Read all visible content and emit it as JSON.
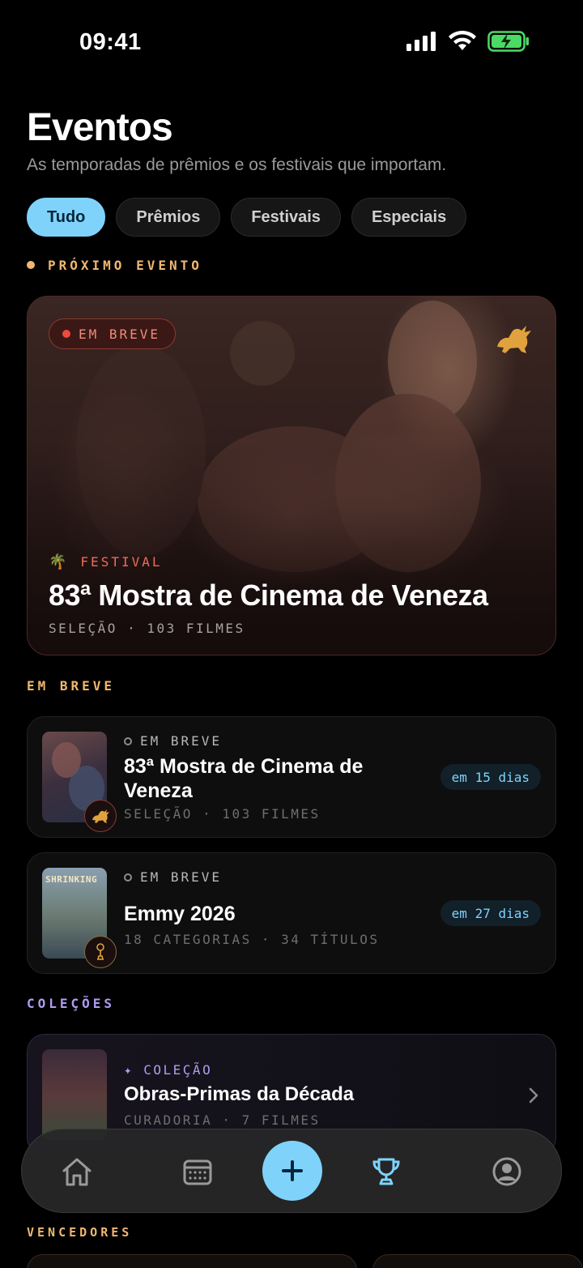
{
  "status_bar": {
    "time": "09:41"
  },
  "header": {
    "title": "Eventos",
    "subtitle": "As temporadas de prêmios e os festivais que importam."
  },
  "filters": [
    {
      "label": "Tudo",
      "active": true
    },
    {
      "label": "Prêmios",
      "active": false
    },
    {
      "label": "Festivais",
      "active": false
    },
    {
      "label": "Especiais",
      "active": false
    }
  ],
  "next_event": {
    "section_label": "PRÓXIMO EVENTO",
    "badge": "EM BREVE",
    "kind": "FESTIVAL",
    "title": "83ª Mostra de Cinema de Veneza",
    "meta": "SELEÇÃO · 103 FILMES"
  },
  "upcoming": {
    "section_label": "EM BREVE",
    "items": [
      {
        "status": "EM BREVE",
        "title": "83ª Mostra de Cinema de Veneza",
        "meta": "SELEÇÃO · 103 FILMES",
        "countdown": "em 15 dias"
      },
      {
        "status": "EM BREVE",
        "title": "Emmy 2026",
        "meta": "18 CATEGORIAS · 34 TÍTULOS",
        "countdown": "em 27 dias",
        "poster_text": "SHRINKING"
      }
    ]
  },
  "collections": {
    "section_label": "COLEÇÕES",
    "items": [
      {
        "tag": "✦ COLEÇÃO",
        "title": "Obras-Primas da Década",
        "meta": "CURADORIA · 7 FILMES"
      }
    ]
  },
  "winners": {
    "section_label": "VENCEDORES"
  },
  "colors": {
    "accent": "#7fd3fb",
    "gold": "#f0b770",
    "festival_red": "#f06b57",
    "collection_purple": "#b09cf0"
  },
  "tabbar": [
    "home-icon",
    "calendar-icon",
    "plus-icon",
    "trophy-icon",
    "profile-icon"
  ]
}
